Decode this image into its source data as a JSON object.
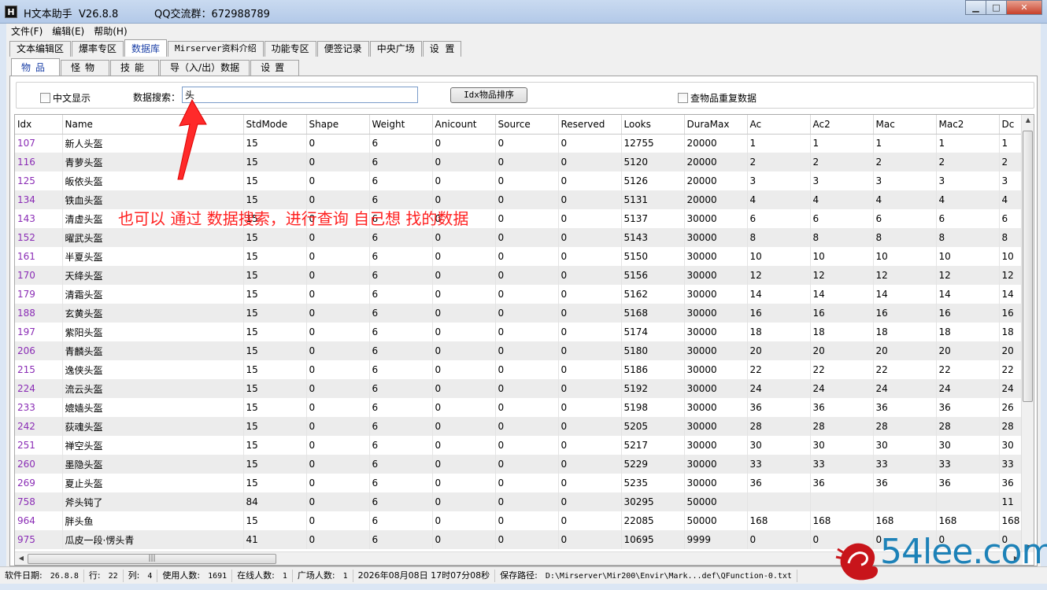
{
  "window": {
    "icon_letter": "H",
    "title": "H文本助手  V26.8.8",
    "qq_group": "QQ交流群：672988789",
    "buttons": {
      "minimize": "▁",
      "maximize": "□",
      "close": "✕"
    }
  },
  "menu": [
    "文件(F)",
    "编辑(E)",
    "帮助(H)"
  ],
  "main_tabs": [
    "文本编辑区",
    "爆率专区",
    "数据库",
    "Mirserver资料介绍",
    "功能专区",
    "便签记录",
    "中央广场",
    "设  置"
  ],
  "active_main_tab": 2,
  "sub_tabs": [
    "物品",
    "怪物",
    "技能",
    "导（入/出）数据",
    "设置"
  ],
  "active_sub_tab": 0,
  "search": {
    "chinese_display_label": "中文显示",
    "search_label": "数据搜索：",
    "search_value": "头",
    "sort_button": "Idx物品排序",
    "duplicate_label": "查物品重复数据"
  },
  "table": {
    "columns": [
      "Idx",
      "Name",
      "StdMode",
      "Shape",
      "Weight",
      "Anicount",
      "Source",
      "Reserved",
      "Looks",
      "DuraMax",
      "Ac",
      "Ac2",
      "Mac",
      "Mac2",
      "Dc"
    ],
    "rows": [
      [
        "107",
        "新人头盔",
        "15",
        "0",
        "6",
        "0",
        "0",
        "0",
        "12755",
        "20000",
        "1",
        "1",
        "1",
        "1",
        "1"
      ],
      [
        "116",
        "青萝头盔",
        "15",
        "0",
        "6",
        "0",
        "0",
        "0",
        "5120",
        "20000",
        "2",
        "2",
        "2",
        "2",
        "2"
      ],
      [
        "125",
        "皈依头盔",
        "15",
        "0",
        "6",
        "0",
        "0",
        "0",
        "5126",
        "20000",
        "3",
        "3",
        "3",
        "3",
        "3"
      ],
      [
        "134",
        "铁血头盔",
        "15",
        "0",
        "6",
        "0",
        "0",
        "0",
        "5131",
        "20000",
        "4",
        "4",
        "4",
        "4",
        "4"
      ],
      [
        "143",
        "清虚头盔",
        "15",
        "0",
        "6",
        "0",
        "0",
        "0",
        "5137",
        "30000",
        "6",
        "6",
        "6",
        "6",
        "6"
      ],
      [
        "152",
        "曜武头盔",
        "15",
        "0",
        "6",
        "0",
        "0",
        "0",
        "5143",
        "30000",
        "8",
        "8",
        "8",
        "8",
        "8"
      ],
      [
        "161",
        "半夏头盔",
        "15",
        "0",
        "6",
        "0",
        "0",
        "0",
        "5150",
        "30000",
        "10",
        "10",
        "10",
        "10",
        "10"
      ],
      [
        "170",
        "天绛头盔",
        "15",
        "0",
        "6",
        "0",
        "0",
        "0",
        "5156",
        "30000",
        "12",
        "12",
        "12",
        "12",
        "12"
      ],
      [
        "179",
        "清霜头盔",
        "15",
        "0",
        "6",
        "0",
        "0",
        "0",
        "5162",
        "30000",
        "14",
        "14",
        "14",
        "14",
        "14"
      ],
      [
        "188",
        "玄黄头盔",
        "15",
        "0",
        "6",
        "0",
        "0",
        "0",
        "5168",
        "30000",
        "16",
        "16",
        "16",
        "16",
        "16"
      ],
      [
        "197",
        "紫阳头盔",
        "15",
        "0",
        "6",
        "0",
        "0",
        "0",
        "5174",
        "30000",
        "18",
        "18",
        "18",
        "18",
        "18"
      ],
      [
        "206",
        "青麟头盔",
        "15",
        "0",
        "6",
        "0",
        "0",
        "0",
        "5180",
        "30000",
        "20",
        "20",
        "20",
        "20",
        "20"
      ],
      [
        "215",
        "逸侠头盔",
        "15",
        "0",
        "6",
        "0",
        "0",
        "0",
        "5186",
        "30000",
        "22",
        "22",
        "22",
        "22",
        "22"
      ],
      [
        "224",
        "流云头盔",
        "15",
        "0",
        "6",
        "0",
        "0",
        "0",
        "5192",
        "30000",
        "24",
        "24",
        "24",
        "24",
        "24"
      ],
      [
        "233",
        "媲嫱头盔",
        "15",
        "0",
        "6",
        "0",
        "0",
        "0",
        "5198",
        "30000",
        "36",
        "36",
        "36",
        "36",
        "26"
      ],
      [
        "242",
        "荻魂头盔",
        "15",
        "0",
        "6",
        "0",
        "0",
        "0",
        "5205",
        "30000",
        "28",
        "28",
        "28",
        "28",
        "28"
      ],
      [
        "251",
        "禅空头盔",
        "15",
        "0",
        "6",
        "0",
        "0",
        "0",
        "5217",
        "30000",
        "30",
        "30",
        "30",
        "30",
        "30"
      ],
      [
        "260",
        "墨隐头盔",
        "15",
        "0",
        "6",
        "0",
        "0",
        "0",
        "5229",
        "30000",
        "33",
        "33",
        "33",
        "33",
        "33"
      ],
      [
        "269",
        "夏止头盔",
        "15",
        "0",
        "6",
        "0",
        "0",
        "0",
        "5235",
        "30000",
        "36",
        "36",
        "36",
        "36",
        "36"
      ],
      [
        "758",
        "斧头钝了",
        "84",
        "0",
        "6",
        "0",
        "0",
        "0",
        "30295",
        "50000",
        "",
        "",
        "",
        "",
        "11"
      ],
      [
        "964",
        "胖头鱼",
        "15",
        "0",
        "6",
        "0",
        "0",
        "0",
        "22085",
        "50000",
        "168",
        "168",
        "168",
        "168",
        "168"
      ],
      [
        "975",
        "瓜皮一段·愣头青",
        "41",
        "0",
        "6",
        "0",
        "0",
        "0",
        "10695",
        "9999",
        "0",
        "0",
        "0",
        "0",
        "0"
      ]
    ]
  },
  "annotation": "也可以 通过 数据搜索，进行查询 自己想 找的数据",
  "status": [
    {
      "label": "软件日期:",
      "value": "26.8.8"
    },
    {
      "label": "行:",
      "value": "22"
    },
    {
      "label": "列:",
      "value": "4"
    },
    {
      "label": "使用人数:",
      "value": "1691"
    },
    {
      "label": "在线人数:",
      "value": "1"
    },
    {
      "label": "广场人数:",
      "value": "1"
    },
    {
      "label": "",
      "value": "2026年08月08日 17时07分08秒"
    },
    {
      "label": "保存路径:",
      "value": "D:\\Mirserver\\Mir200\\Envir\\Mark...def\\QFunction-0.txt"
    }
  ],
  "watermark": "54lee.com"
}
